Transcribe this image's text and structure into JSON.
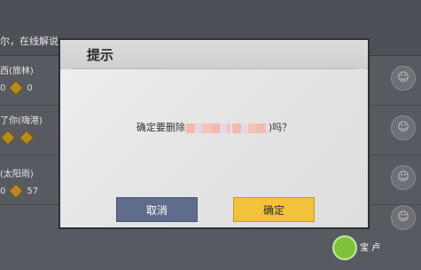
{
  "background": {
    "header_text": "尔，在线解说",
    "rows": [
      {
        "name": "西(旅林)",
        "left_count": "0",
        "right_count": "0"
      },
      {
        "name": "了你(嗨港)",
        "left_count": "",
        "right_count": ""
      },
      {
        "name": "(太阳雨)",
        "left_count": "0",
        "right_count": "57"
      }
    ]
  },
  "dialog": {
    "title": "提示",
    "message_prefix": "确定要删除",
    "message_suffix": ")吗？",
    "cancel_label": "取消",
    "confirm_label": "确定"
  },
  "watermark": {
    "text": "宝 卢"
  },
  "icons": {
    "avatar": "user-avatar-icon",
    "gem": "gem-icon",
    "logo": "pacman-logo-icon"
  }
}
